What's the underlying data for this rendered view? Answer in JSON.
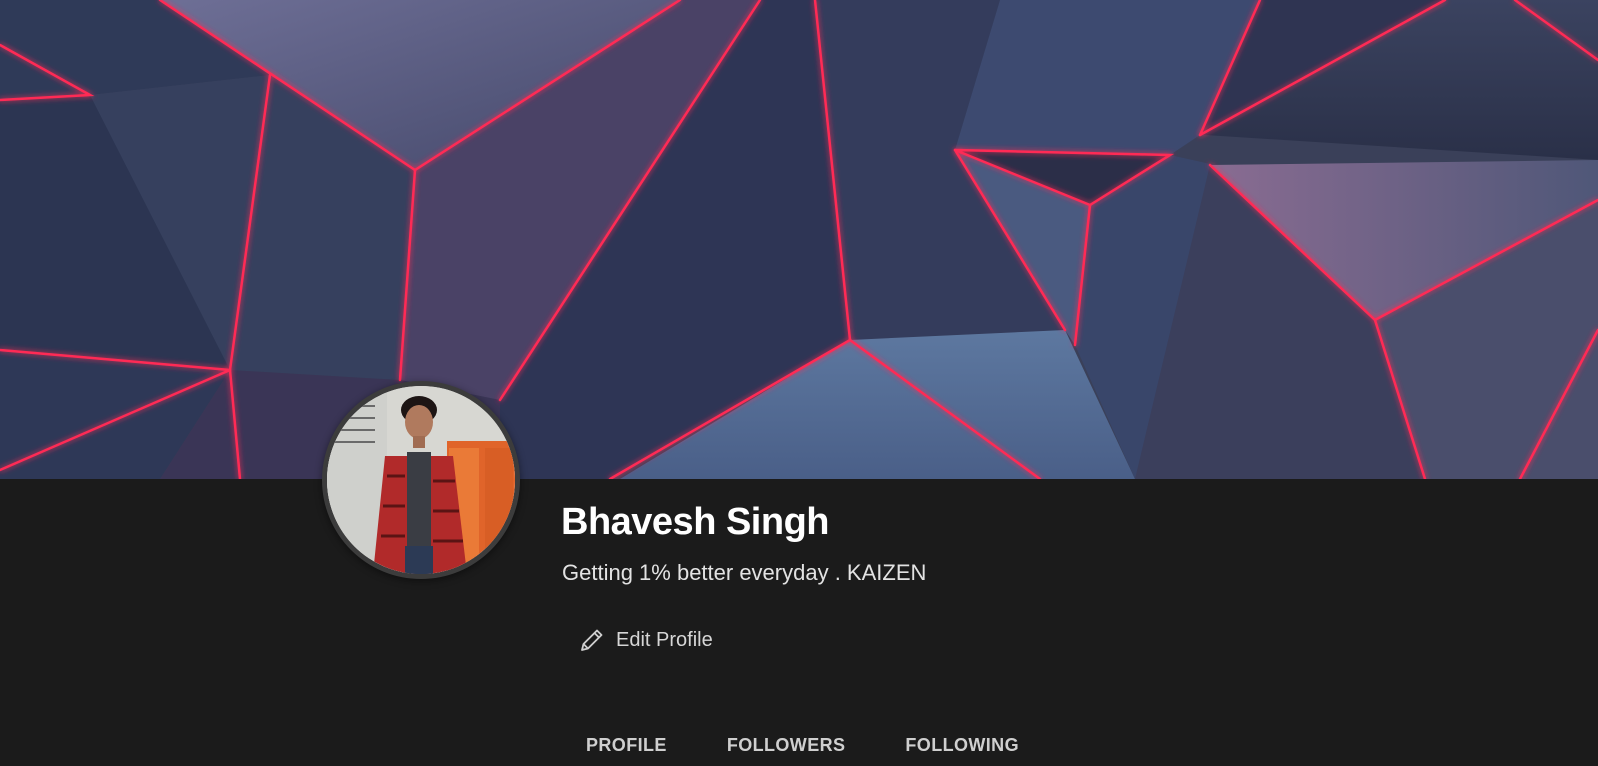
{
  "profile": {
    "name": "Bhavesh Singh",
    "bio": "Getting 1% better everyday . KAIZEN",
    "cover_image": "abstract-geometric-neon-cover",
    "avatar_image": "profile-photo"
  },
  "actions": {
    "edit_profile_label": "Edit Profile",
    "edit_icon": "pencil-icon"
  },
  "tabs": [
    {
      "label": "PROFILE"
    },
    {
      "label": "FOLLOWERS"
    },
    {
      "label": "FOLLOWING"
    }
  ],
  "colors": {
    "page_background": "#1b1b1b",
    "neon_accent": "#ff2b55",
    "text_primary": "#ffffff",
    "text_secondary": "#e3e3e3"
  }
}
